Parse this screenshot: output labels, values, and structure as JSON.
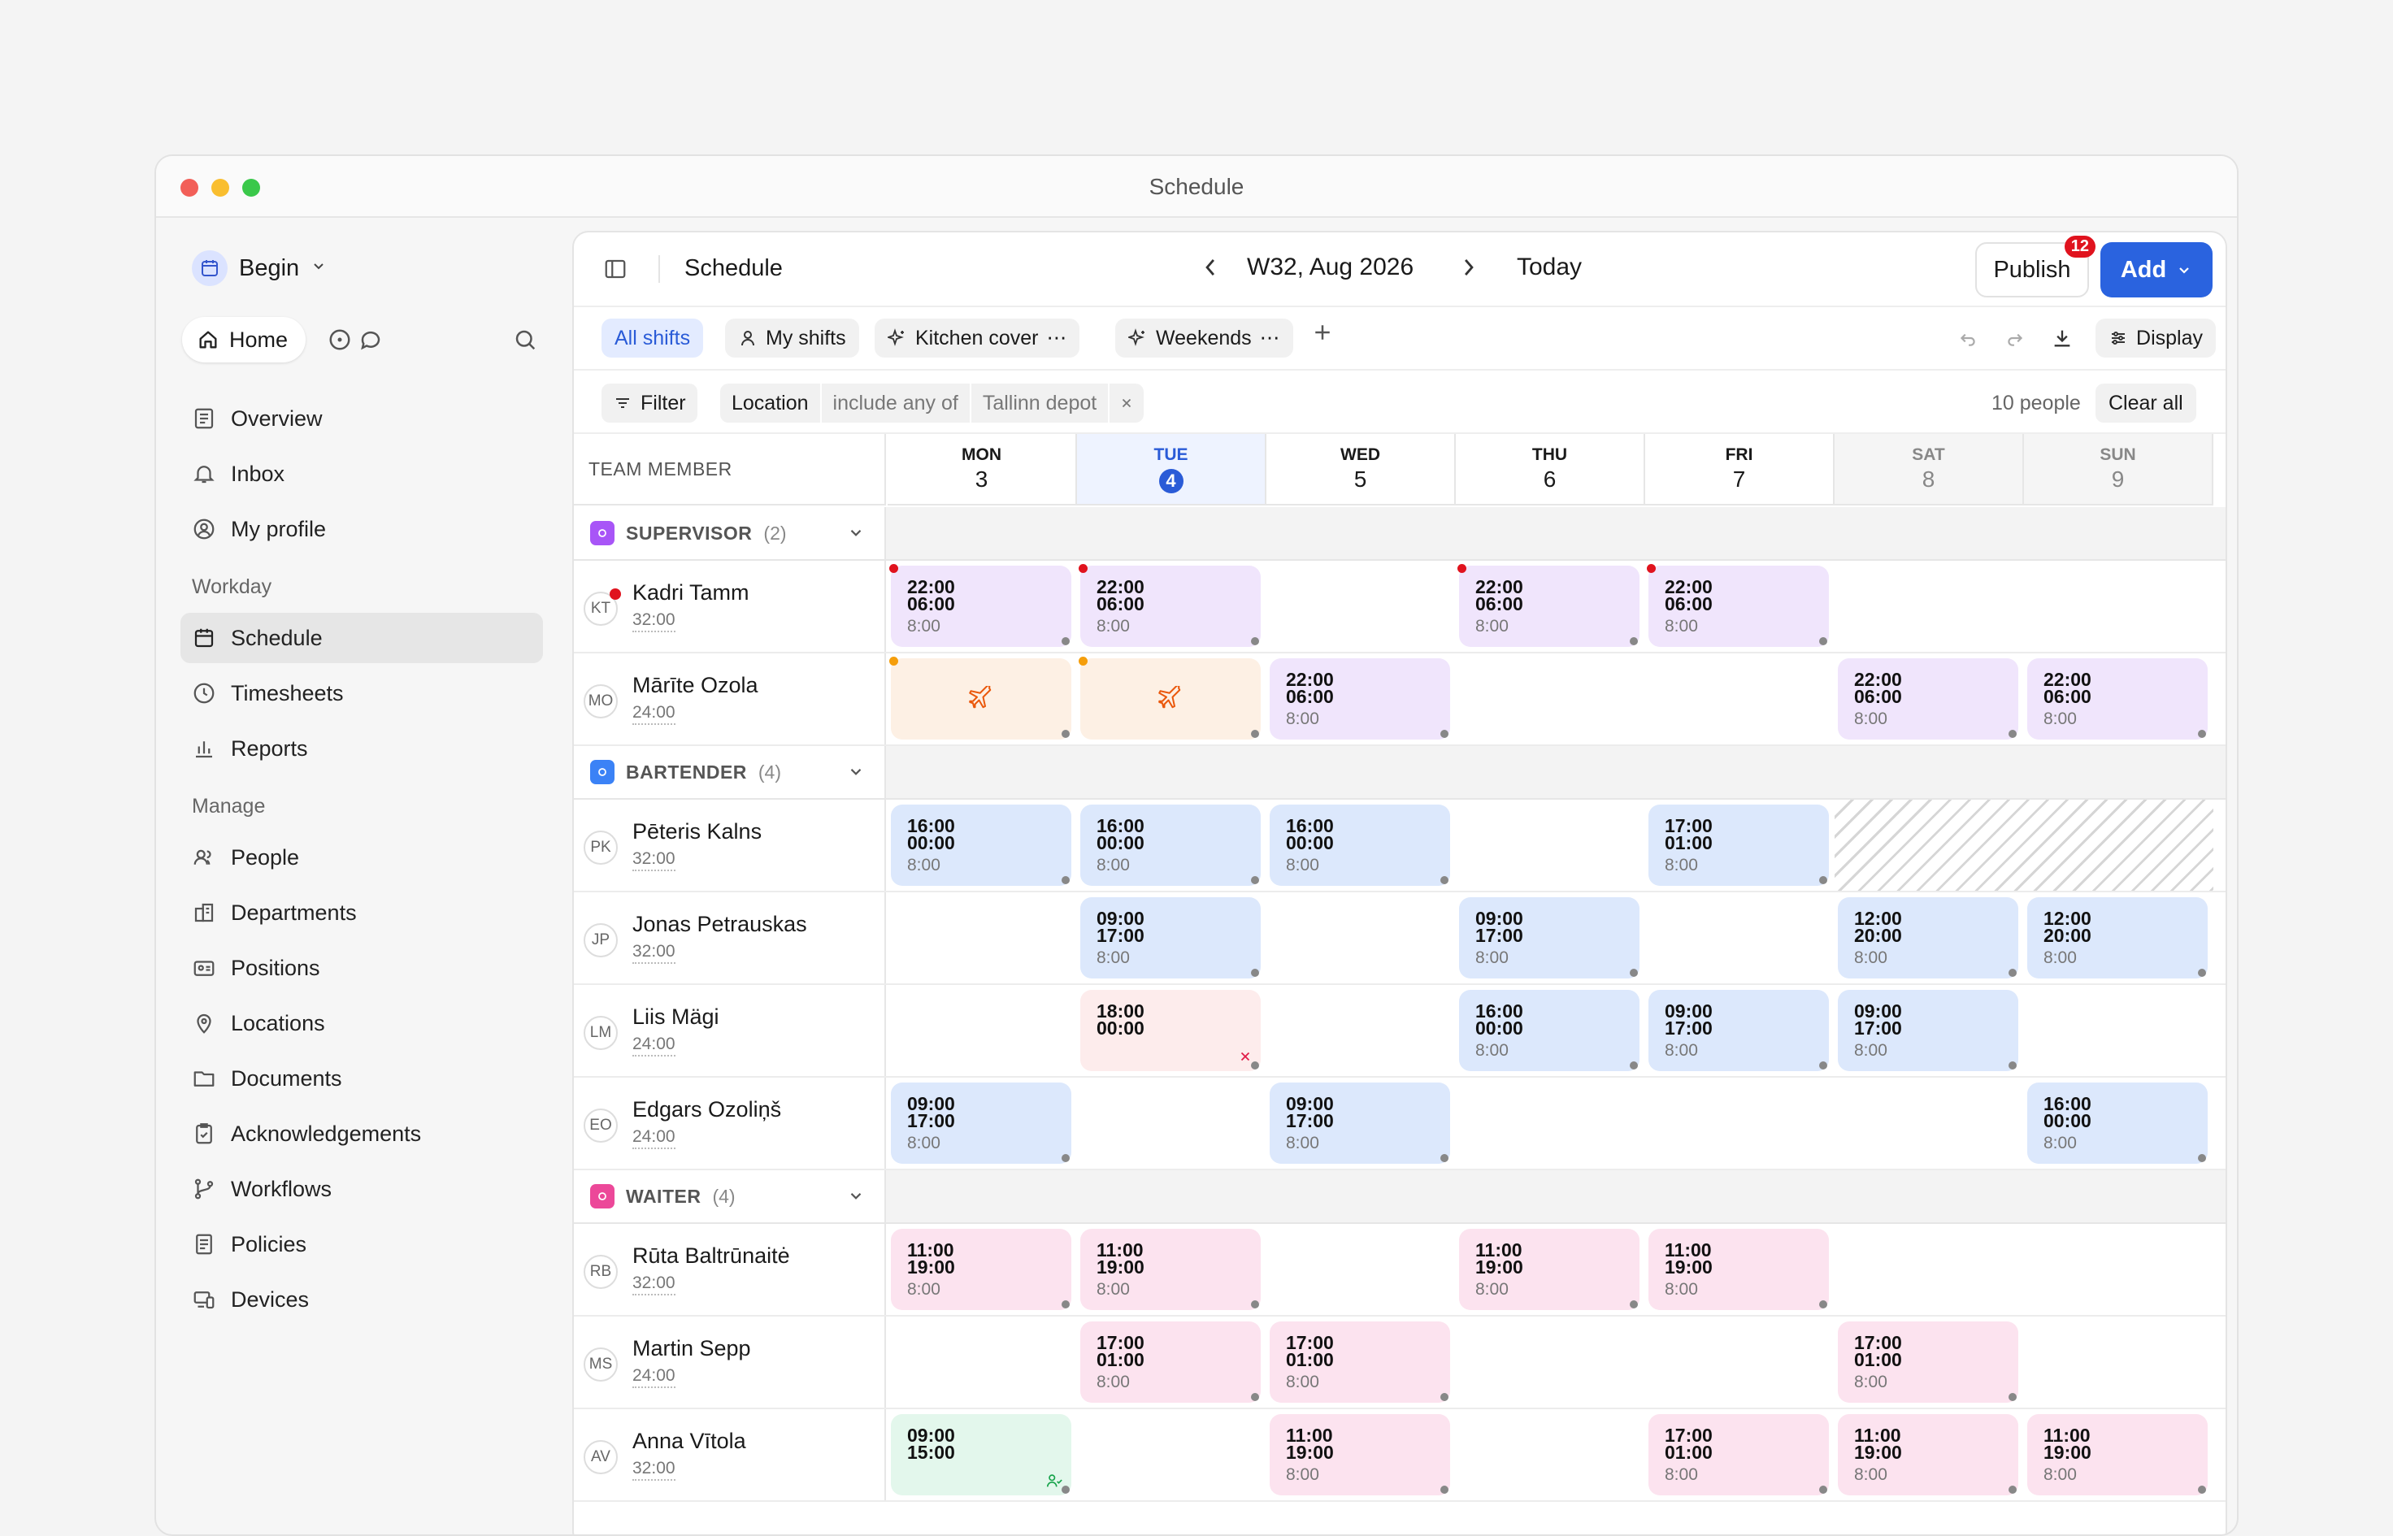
{
  "window": {
    "title": "Schedule"
  },
  "workspace": {
    "name": "Begin"
  },
  "topnav": {
    "home_label": "Home"
  },
  "nav": {
    "main": [
      {
        "label": "Overview",
        "icon": "newspaper-icon"
      },
      {
        "label": "Inbox",
        "icon": "bell-icon"
      },
      {
        "label": "My profile",
        "icon": "user-circle-icon"
      }
    ],
    "workday_heading": "Workday",
    "workday": [
      {
        "label": "Schedule",
        "icon": "calendar-icon",
        "active": true
      },
      {
        "label": "Timesheets",
        "icon": "clock-icon"
      },
      {
        "label": "Reports",
        "icon": "bar-chart-icon"
      }
    ],
    "manage_heading": "Manage",
    "manage": [
      {
        "label": "People",
        "icon": "users-icon"
      },
      {
        "label": "Departments",
        "icon": "building-icon"
      },
      {
        "label": "Positions",
        "icon": "id-card-icon"
      },
      {
        "label": "Locations",
        "icon": "map-pin-icon"
      },
      {
        "label": "Documents",
        "icon": "folder-icon"
      },
      {
        "label": "Acknowledgements",
        "icon": "clipboard-check-icon"
      },
      {
        "label": "Workflows",
        "icon": "git-branch-icon"
      },
      {
        "label": "Policies",
        "icon": "book-icon"
      },
      {
        "label": "Devices",
        "icon": "devices-icon"
      }
    ]
  },
  "header": {
    "title": "Schedule",
    "week_label": "W32, Aug 2026",
    "today_label": "Today",
    "publish_label": "Publish",
    "publish_badge": "12",
    "add_label": "Add"
  },
  "views": {
    "tabs": [
      "All shifts",
      "My shifts",
      "Kitchen cover",
      "Weekends"
    ],
    "display_label": "Display"
  },
  "filters": {
    "filter_label": "Filter",
    "field": "Location",
    "operator": "include any of",
    "value": "Tallinn depot",
    "people_count": "10 people",
    "clear_label": "Clear all"
  },
  "grid": {
    "member_header": "TEAM MEMBER",
    "days": [
      {
        "name": "MON",
        "date": "3"
      },
      {
        "name": "TUE",
        "date": "4",
        "today": true
      },
      {
        "name": "WED",
        "date": "5"
      },
      {
        "name": "THU",
        "date": "6"
      },
      {
        "name": "FRI",
        "date": "7"
      },
      {
        "name": "SAT",
        "date": "8",
        "weekend": true
      },
      {
        "name": "SUN",
        "date": "9",
        "weekend": true
      }
    ]
  },
  "groups": [
    {
      "name": "SUPERVISOR",
      "count": "(2)",
      "color": "#a855f7",
      "people": [
        {
          "initials": "KT",
          "name": "Kadri Tamm",
          "hours": "32:00",
          "notify": true,
          "shifts": [
            {
              "day": 0,
              "start": "22:00",
              "end": "06:00",
              "dur": "8:00",
              "color": "purple",
              "flag": "#e0131e"
            },
            {
              "day": 1,
              "start": "22:00",
              "end": "06:00",
              "dur": "8:00",
              "color": "purple",
              "flag": "#e0131e"
            },
            {
              "day": 3,
              "start": "22:00",
              "end": "06:00",
              "dur": "8:00",
              "color": "purple",
              "flag": "#e0131e"
            },
            {
              "day": 4,
              "start": "22:00",
              "end": "06:00",
              "dur": "8:00",
              "color": "purple",
              "flag": "#e0131e"
            }
          ]
        },
        {
          "initials": "MO",
          "name": "Mārīte Ozola",
          "hours": "24:00",
          "shifts": [
            {
              "day": 0,
              "kind": "leave",
              "color": "orange",
              "flag": "#f59e0b"
            },
            {
              "day": 1,
              "kind": "leave",
              "color": "orange",
              "flag": "#f59e0b"
            },
            {
              "day": 2,
              "start": "22:00",
              "end": "06:00",
              "dur": "8:00",
              "color": "purple"
            },
            {
              "day": 5,
              "start": "22:00",
              "end": "06:00",
              "dur": "8:00",
              "color": "purple"
            },
            {
              "day": 6,
              "start": "22:00",
              "end": "06:00",
              "dur": "8:00",
              "color": "purple"
            }
          ]
        }
      ]
    },
    {
      "name": "BARTENDER",
      "count": "(4)",
      "color": "#3b82f6",
      "people": [
        {
          "initials": "PK",
          "name": "Pēteris Kalns",
          "hours": "32:00",
          "unavailable_days": [
            5,
            6
          ],
          "shifts": [
            {
              "day": 0,
              "start": "16:00",
              "end": "00:00",
              "dur": "8:00",
              "color": "blue"
            },
            {
              "day": 1,
              "start": "16:00",
              "end": "00:00",
              "dur": "8:00",
              "color": "blue"
            },
            {
              "day": 2,
              "start": "16:00",
              "end": "00:00",
              "dur": "8:00",
              "color": "blue"
            },
            {
              "day": 4,
              "start": "17:00",
              "end": "01:00",
              "dur": "8:00",
              "color": "blue"
            }
          ]
        },
        {
          "initials": "JP",
          "name": "Jonas Petrauskas",
          "hours": "32:00",
          "shifts": [
            {
              "day": 1,
              "start": "09:00",
              "end": "17:00",
              "dur": "8:00",
              "color": "blue"
            },
            {
              "day": 3,
              "start": "09:00",
              "end": "17:00",
              "dur": "8:00",
              "color": "blue"
            },
            {
              "day": 5,
              "start": "12:00",
              "end": "20:00",
              "dur": "8:00",
              "color": "blue"
            },
            {
              "day": 6,
              "start": "12:00",
              "end": "20:00",
              "dur": "8:00",
              "color": "blue"
            }
          ]
        },
        {
          "initials": "LM",
          "name": "Liis Mägi",
          "hours": "24:00",
          "shifts": [
            {
              "day": 1,
              "start": "18:00",
              "end": "00:00",
              "color": "red",
              "kind": "cancelled"
            },
            {
              "day": 3,
              "start": "16:00",
              "end": "00:00",
              "dur": "8:00",
              "color": "blue"
            },
            {
              "day": 4,
              "start": "09:00",
              "end": "17:00",
              "dur": "8:00",
              "color": "blue"
            },
            {
              "day": 5,
              "start": "09:00",
              "end": "17:00",
              "dur": "8:00",
              "color": "blue"
            }
          ]
        },
        {
          "initials": "EO",
          "name": "Edgars Ozoliņš",
          "hours": "24:00",
          "shifts": [
            {
              "day": 0,
              "start": "09:00",
              "end": "17:00",
              "dur": "8:00",
              "color": "blue"
            },
            {
              "day": 2,
              "start": "09:00",
              "end": "17:00",
              "dur": "8:00",
              "color": "blue"
            },
            {
              "day": 6,
              "start": "16:00",
              "end": "00:00",
              "dur": "8:00",
              "color": "blue"
            }
          ]
        }
      ]
    },
    {
      "name": "WAITER",
      "count": "(4)",
      "color": "#ec4899",
      "people": [
        {
          "initials": "RB",
          "name": "Rūta Baltrūnaitė",
          "hours": "32:00",
          "shifts": [
            {
              "day": 0,
              "start": "11:00",
              "end": "19:00",
              "dur": "8:00",
              "color": "pink"
            },
            {
              "day": 1,
              "start": "11:00",
              "end": "19:00",
              "dur": "8:00",
              "color": "pink"
            },
            {
              "day": 3,
              "start": "11:00",
              "end": "19:00",
              "dur": "8:00",
              "color": "pink"
            },
            {
              "day": 4,
              "start": "11:00",
              "end": "19:00",
              "dur": "8:00",
              "color": "pink"
            }
          ]
        },
        {
          "initials": "MS",
          "name": "Martin Sepp",
          "hours": "24:00",
          "shifts": [
            {
              "day": 1,
              "start": "17:00",
              "end": "01:00",
              "dur": "8:00",
              "color": "pink"
            },
            {
              "day": 2,
              "start": "17:00",
              "end": "01:00",
              "dur": "8:00",
              "color": "pink"
            },
            {
              "day": 5,
              "start": "17:00",
              "end": "01:00",
              "dur": "8:00",
              "color": "pink"
            }
          ]
        },
        {
          "initials": "AV",
          "name": "Anna Vītola",
          "hours": "32:00",
          "shifts": [
            {
              "day": 0,
              "start": "09:00",
              "end": "15:00",
              "color": "green",
              "kind": "open"
            },
            {
              "day": 2,
              "start": "11:00",
              "end": "19:00",
              "dur": "8:00",
              "color": "pink"
            },
            {
              "day": 4,
              "start": "17:00",
              "end": "01:00",
              "dur": "8:00",
              "color": "pink"
            },
            {
              "day": 5,
              "start": "11:00",
              "end": "19:00",
              "dur": "8:00",
              "color": "pink"
            },
            {
              "day": 6,
              "start": "11:00",
              "end": "19:00",
              "dur": "8:00",
              "color": "pink"
            }
          ]
        }
      ]
    }
  ]
}
